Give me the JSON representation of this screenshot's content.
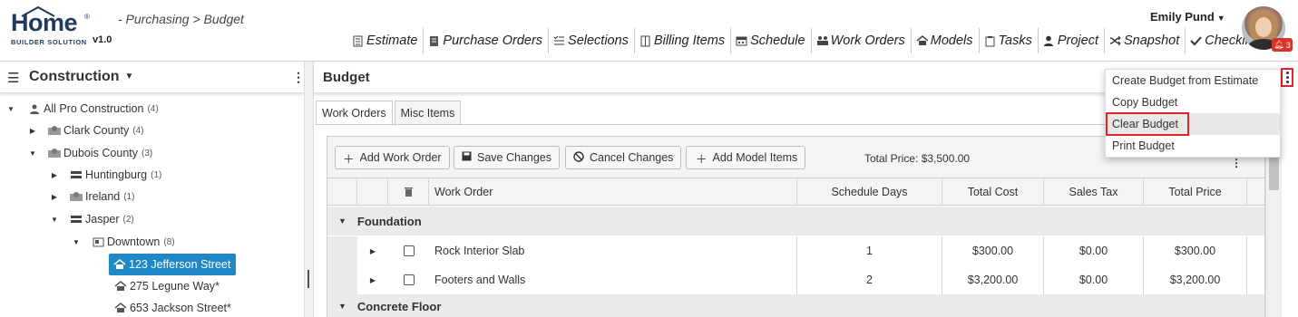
{
  "app": {
    "logo_text": "Home",
    "logo_sub": "BUILDER SOLUTION",
    "version": "v1.0",
    "breadcrumb": "- Purchasing > Budget"
  },
  "topnav": [
    {
      "label": "Estimate",
      "icon": "document-icon"
    },
    {
      "label": "Purchase Orders",
      "icon": "receipt-icon"
    },
    {
      "label": "Selections",
      "icon": "checklist-icon"
    },
    {
      "label": "Billing Items",
      "icon": "ledger-icon"
    },
    {
      "label": "Schedule",
      "icon": "calendar-icon"
    },
    {
      "label": "Work Orders",
      "icon": "workers-icon"
    },
    {
      "label": "Models",
      "icon": "house-icon"
    },
    {
      "label": "Tasks",
      "icon": "clipboard-icon"
    },
    {
      "label": "Project",
      "icon": "person-icon"
    },
    {
      "label": "Snapshot",
      "icon": "shuffle-icon"
    },
    {
      "label": "Checklist",
      "icon": "check-icon"
    }
  ],
  "user": {
    "name": "Emily Pund",
    "notifications": "3"
  },
  "left_panel": {
    "title": "Construction",
    "tree": [
      {
        "label": "All Pro Construction",
        "count": "(4)"
      },
      {
        "label": "Clark County",
        "count": "(4)"
      },
      {
        "label": "Dubois County",
        "count": "(3)"
      },
      {
        "label": "Huntingburg",
        "count": "(1)"
      },
      {
        "label": "Ireland",
        "count": "(1)"
      },
      {
        "label": "Jasper",
        "count": "(2)"
      },
      {
        "label": "Downtown",
        "count": "(8)"
      },
      {
        "label": "123 Jefferson Street",
        "count": ""
      },
      {
        "label": "275 Legune Way*",
        "count": ""
      },
      {
        "label": "653 Jackson Street*",
        "count": ""
      }
    ]
  },
  "main": {
    "title": "Budget",
    "tabs": [
      "Work Orders",
      "Misc Items"
    ],
    "toolbar": {
      "add_work_order": "Add Work Order",
      "save_changes": "Save Changes",
      "cancel_changes": "Cancel Changes",
      "add_model_items": "Add Model Items",
      "total_price": "Total Price: $3,500.00"
    },
    "columns": [
      "Work Order",
      "Schedule Days",
      "Total Cost",
      "Sales Tax",
      "Total Price"
    ],
    "groups": [
      {
        "name": "Foundation",
        "rows": [
          {
            "work_order": "Rock Interior Slab",
            "schedule_days": "1",
            "total_cost": "$300.00",
            "sales_tax": "$0.00",
            "total_price": "$300.00"
          },
          {
            "work_order": "Footers and Walls",
            "schedule_days": "2",
            "total_cost": "$3,200.00",
            "sales_tax": "$0.00",
            "total_price": "$3,200.00"
          }
        ]
      },
      {
        "name": "Concrete Floor",
        "rows": []
      }
    ]
  },
  "menu": {
    "items": [
      "Create Budget from Estimate",
      "Copy Budget",
      "Clear Budget",
      "Print Budget"
    ],
    "highlighted": "Clear Budget",
    "highlight_color": "#e0262a"
  }
}
